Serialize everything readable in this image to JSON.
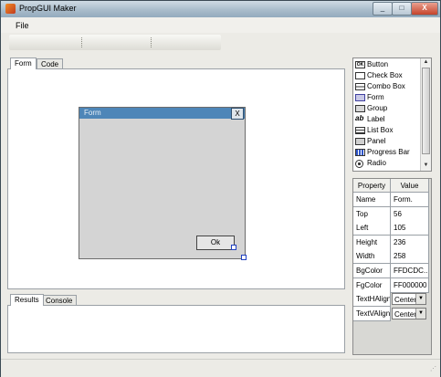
{
  "window": {
    "title": "PropGUI Maker",
    "controls": {
      "minimize": "_",
      "maximize": "□",
      "close": "X"
    }
  },
  "menu": {
    "file": "File"
  },
  "designer_tabs": [
    {
      "label": "Form"
    },
    {
      "label": "Code"
    }
  ],
  "form_preview": {
    "title": "Form",
    "close_label": "X",
    "ok_label": "Ok"
  },
  "output_tabs": [
    {
      "label": "Results"
    },
    {
      "label": "Console"
    }
  ],
  "toolbox": {
    "items": [
      {
        "label": "Button",
        "icon": "button-icon"
      },
      {
        "label": "Check Box",
        "icon": "checkbox-icon"
      },
      {
        "label": "Combo Box",
        "icon": "combobox-icon"
      },
      {
        "label": "Form",
        "icon": "form-icon"
      },
      {
        "label": "Group",
        "icon": "group-icon"
      },
      {
        "label": "Label",
        "icon": "label-icon",
        "glyph": "ab"
      },
      {
        "label": "List Box",
        "icon": "listbox-icon"
      },
      {
        "label": "Panel",
        "icon": "panel-icon"
      },
      {
        "label": "Progress Bar",
        "icon": "progressbar-icon"
      },
      {
        "label": "Radio",
        "icon": "radio-icon"
      }
    ]
  },
  "properties": {
    "header": {
      "property": "Property",
      "value": "Value"
    },
    "rows": [
      {
        "name": "Name",
        "value": "Form."
      },
      {
        "name": "Top",
        "value": "56"
      },
      {
        "name": "Left",
        "value": "105"
      },
      {
        "name": "Height",
        "value": "236"
      },
      {
        "name": "Width",
        "value": "258"
      },
      {
        "name": "BgColor",
        "value": "FFDCDC..."
      },
      {
        "name": "FgColor",
        "value": "FF000000"
      },
      {
        "name": "TextHAlign",
        "value": "Center",
        "combo": true
      },
      {
        "name": "TextVAlign",
        "value": "Center",
        "combo": true
      }
    ]
  },
  "colors": {
    "form_title_bar": "#4e86b8",
    "form_body": "#d4d4d4",
    "selection_handle": "#2040c0"
  }
}
